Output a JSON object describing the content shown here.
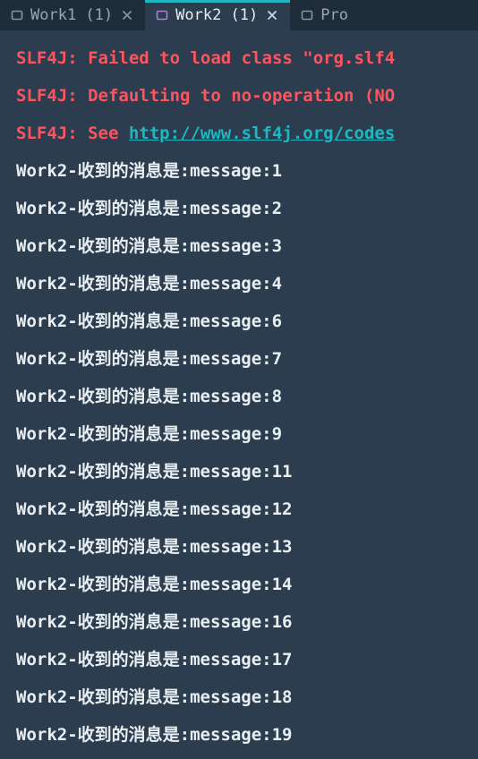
{
  "tabs": [
    {
      "label": "Work1 (1)",
      "active": false,
      "closable": true
    },
    {
      "label": "Work2 (1)",
      "active": true,
      "closable": true
    },
    {
      "label": "Pro",
      "active": false,
      "closable": false
    }
  ],
  "console": {
    "error_lines": [
      {
        "prefix": "SLF4J: Failed to load class \"org.slf4"
      },
      {
        "prefix": "SLF4J: Defaulting to no-operation (NO"
      },
      {
        "prefix": "SLF4J: See ",
        "url": "http://www.slf4j.org/codes"
      }
    ],
    "message_prefix": "Work2-收到的消息是:message:",
    "message_numbers": [
      1,
      2,
      3,
      4,
      6,
      7,
      8,
      9,
      11,
      12,
      13,
      14,
      16,
      17,
      18,
      19
    ]
  }
}
